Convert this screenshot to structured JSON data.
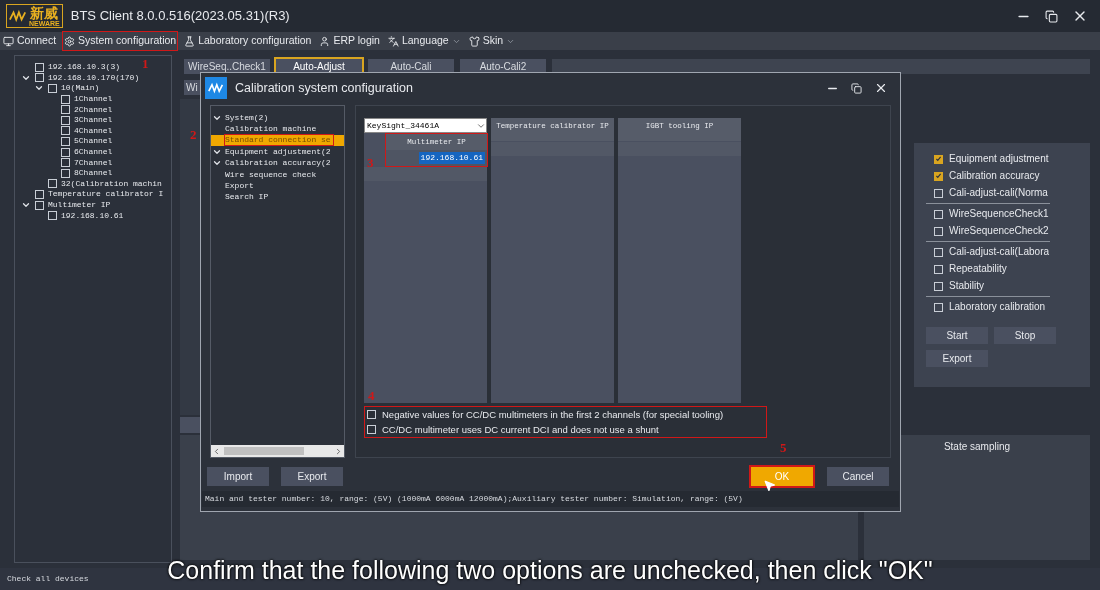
{
  "app": {
    "logo_text": "新威",
    "logo_sub": "NEWARE",
    "title": "BTS Client 8.0.0.516(2023.05.31)(R3)"
  },
  "menu": [
    {
      "kind": "connect",
      "label": "Connect",
      "highlighted": false
    },
    {
      "kind": "settings",
      "label": "System configuration",
      "highlighted": true
    },
    {
      "kind": "lab",
      "label": "Laboratory configuration",
      "highlighted": false
    },
    {
      "kind": "user",
      "label": "ERP login",
      "highlighted": false
    },
    {
      "kind": "language",
      "label": "Language",
      "highlighted": false,
      "dropdown": true
    },
    {
      "kind": "skin",
      "label": "Skin",
      "highlighted": false,
      "dropdown": true
    }
  ],
  "device_tree": [
    {
      "label": "192.168.10.3(3)",
      "checked": false
    },
    {
      "label": "192.168.10.170(170)",
      "checked": false,
      "expanded": true,
      "children": [
        {
          "label": "10(Main)",
          "checked": false,
          "expanded": true,
          "children": [
            {
              "label": "1Channel",
              "checked": false
            },
            {
              "label": "2Channel",
              "checked": false
            },
            {
              "label": "3Channel",
              "checked": false
            },
            {
              "label": "4Channel",
              "checked": false
            },
            {
              "label": "5Channel",
              "checked": false
            },
            {
              "label": "6Channel",
              "checked": false
            },
            {
              "label": "7Channel",
              "checked": false
            },
            {
              "label": "8Channel",
              "checked": false
            }
          ]
        },
        {
          "label": "32(Calibration machin",
          "checked": false
        }
      ]
    },
    {
      "label": "Temperature calibrator I",
      "checked": false
    },
    {
      "label": "Multimeter IP",
      "checked": false,
      "expanded": true,
      "children": [
        {
          "label": "192.168.10.61",
          "checked": false
        }
      ]
    }
  ],
  "tabs": [
    {
      "label": "WireSeq..Check1",
      "selected": false
    },
    {
      "label": "Auto-Adjust",
      "selected": true
    },
    {
      "label": "Auto-Cali",
      "selected": false
    },
    {
      "label": "Auto-Cali2",
      "selected": false
    }
  ],
  "second_tab": "Wi",
  "option_groups": [
    {
      "options": [
        {
          "label": "Equipment adjustment",
          "checked": true
        },
        {
          "label": "Calibration accuracy",
          "checked": true
        },
        {
          "label": "Cali-adjust-cali(Norma",
          "checked": false
        }
      ]
    },
    {
      "options": [
        {
          "label": "WireSequenceCheck1",
          "checked": false
        },
        {
          "label": "WireSequenceCheck2",
          "checked": false
        }
      ]
    },
    {
      "options": [
        {
          "label": "Cali-adjust-cali(Labora",
          "checked": false
        },
        {
          "label": "Repeatability",
          "checked": false
        },
        {
          "label": "Stability",
          "checked": false
        }
      ]
    },
    {
      "options": [
        {
          "label": "Laboratory calibration",
          "checked": false
        }
      ]
    }
  ],
  "option_buttons": [
    "Start",
    "Stop",
    "Export"
  ],
  "state_sampling": "State sampling",
  "status_text": "Check all devices",
  "dialog": {
    "title": "Calibration system configuration",
    "tree": [
      {
        "label": "System(2)",
        "expanded": true,
        "selected": false,
        "children": [
          {
            "label": "Calibration machine",
            "selected": false
          },
          {
            "label": "Standard connection se",
            "selected": true
          }
        ]
      },
      {
        "label": "Equipment adjustment(2",
        "expanded": true,
        "selected": false
      },
      {
        "label": "Calibration accuracy(2",
        "expanded": true,
        "selected": false
      },
      {
        "label": "Wire sequence check",
        "selected": false
      },
      {
        "label": "Export",
        "selected": false
      },
      {
        "label": "Search IP",
        "selected": false
      }
    ],
    "device_select": "KeySight_34461A",
    "columns": [
      {
        "header": "Multimeter IP",
        "rows": [
          {
            "value": "192.168.10.61",
            "selected": true
          }
        ]
      },
      {
        "header": "Temperature calibrator IP"
      },
      {
        "header": "IGBT tooling IP"
      }
    ],
    "options": [
      {
        "label": "Negative values for CC/DC multimeters in the first 2 channels (for special tooling)",
        "checked": false
      },
      {
        "label": "CC/DC multimeter uses DC current DCI and does not use a shunt",
        "checked": false
      }
    ],
    "left_buttons": [
      "Import",
      "Export"
    ],
    "ok": {
      "label": "OK",
      "highlighted": true
    },
    "cancel": "Cancel",
    "status": "Main and tester number: 10, range: (5V) (1000mA 6000mA 12000mA);Auxiliary tester number: Simulation, range: (5V)"
  },
  "annotations": [
    {
      "text": "1"
    },
    {
      "text": "2"
    },
    {
      "text": "3"
    },
    {
      "text": "4"
    },
    {
      "text": "5"
    }
  ],
  "subtitle": "Confirm that the following two options are unchecked, then click \"OK\""
}
